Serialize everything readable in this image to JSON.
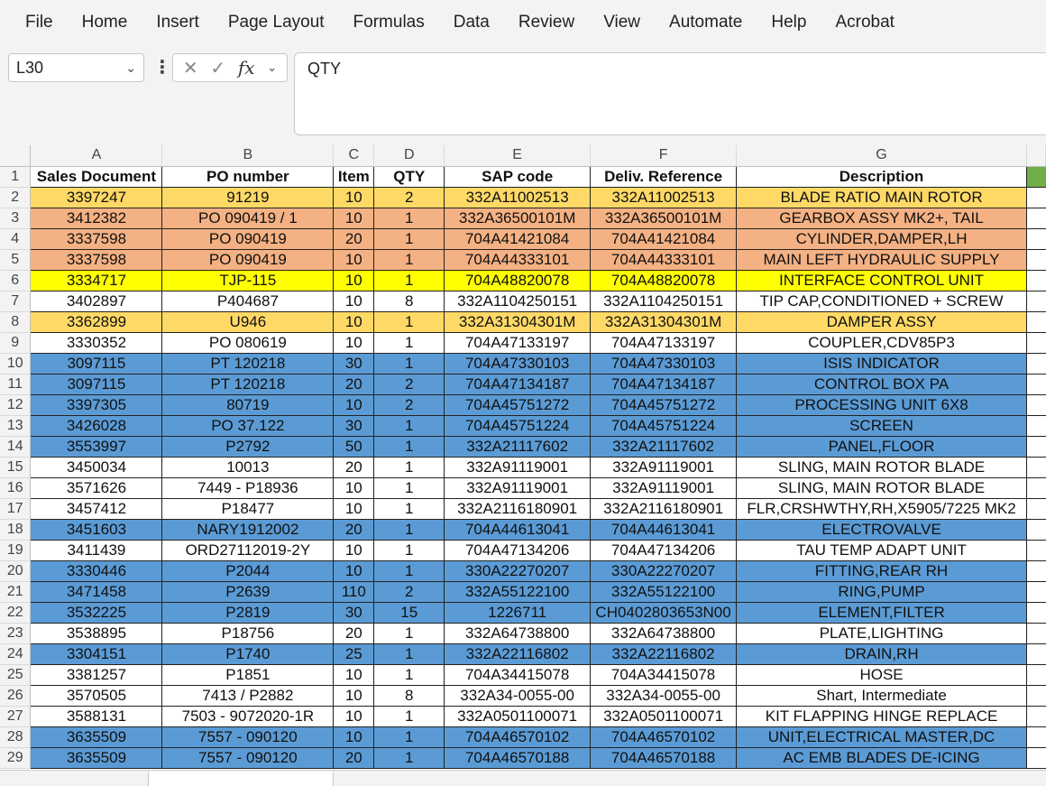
{
  "menu": [
    "File",
    "Home",
    "Insert",
    "Page Layout",
    "Formulas",
    "Data",
    "Review",
    "View",
    "Automate",
    "Help",
    "Acrobat"
  ],
  "name_box": "L30",
  "formula": "QTY",
  "fx_label": "fx",
  "columns": [
    "A",
    "B",
    "C",
    "D",
    "E",
    "F",
    "G"
  ],
  "header": [
    "Sales Document",
    "PO number",
    "Item",
    "QTY",
    "SAP code",
    "Deliv. Reference",
    "Description"
  ],
  "colors": {
    "orange": "#ffd966",
    "salmon": "#f4b183",
    "yellow": "#ffff00",
    "blue": "#5b9bd5",
    "white": "#ffffff",
    "green": "#70ad47"
  },
  "rows": [
    {
      "n": "2",
      "fill": "orange",
      "cells": [
        "3397247",
        "91219",
        "10",
        "2",
        "332A11002513",
        "332A11002513",
        "BLADE RATIO MAIN ROTOR"
      ]
    },
    {
      "n": "3",
      "fill": "salmon",
      "cells": [
        "3412382",
        "PO 090419 / 1",
        "10",
        "1",
        "332A36500101M",
        "332A36500101M",
        "GEARBOX ASSY MK2+, TAIL"
      ]
    },
    {
      "n": "4",
      "fill": "salmon",
      "cells": [
        "3337598",
        "PO 090419",
        "20",
        "1",
        "704A41421084",
        "704A41421084",
        "CYLINDER,DAMPER,LH"
      ]
    },
    {
      "n": "5",
      "fill": "salmon",
      "cells": [
        "3337598",
        "PO 090419",
        "10",
        "1",
        "704A44333101",
        "704A44333101",
        "MAIN LEFT HYDRAULIC SUPPLY"
      ]
    },
    {
      "n": "6",
      "fill": "yellow",
      "cells": [
        "3334717",
        "TJP-115",
        "10",
        "1",
        "704A48820078",
        "704A48820078",
        "INTERFACE CONTROL UNIT"
      ]
    },
    {
      "n": "7",
      "fill": "white",
      "cells": [
        "3402897",
        "P404687",
        "10",
        "8",
        "332A1104250151",
        "332A1104250151",
        "TIP CAP,CONDITIONED + SCREW"
      ]
    },
    {
      "n": "8",
      "fill": "orange",
      "cells": [
        "3362899",
        "U946",
        "10",
        "1",
        "332A31304301M",
        "332A31304301M",
        "DAMPER ASSY"
      ]
    },
    {
      "n": "9",
      "fill": "white",
      "cells": [
        "3330352",
        "PO 080619",
        "10",
        "1",
        "704A47133197",
        "704A47133197",
        "COUPLER,CDV85P3"
      ]
    },
    {
      "n": "10",
      "fill": "blue",
      "cells": [
        "3097115",
        "PT 120218",
        "30",
        "1",
        "704A47330103",
        "704A47330103",
        "ISIS INDICATOR"
      ]
    },
    {
      "n": "11",
      "fill": "blue",
      "cells": [
        "3097115",
        "PT 120218",
        "20",
        "2",
        "704A47134187",
        "704A47134187",
        "CONTROL BOX PA"
      ]
    },
    {
      "n": "12",
      "fill": "blue",
      "cells": [
        "3397305",
        "80719",
        "10",
        "2",
        "704A45751272",
        "704A45751272",
        "PROCESSING UNIT 6X8"
      ]
    },
    {
      "n": "13",
      "fill": "blue",
      "cells": [
        "3426028",
        "PO 37.122",
        "30",
        "1",
        "704A45751224",
        "704A45751224",
        "SCREEN"
      ]
    },
    {
      "n": "14",
      "fill": "blue",
      "cells": [
        "3553997",
        "P2792",
        "50",
        "1",
        "332A21117602",
        "332A21117602",
        "PANEL,FLOOR"
      ]
    },
    {
      "n": "15",
      "fill": "white",
      "cells": [
        "3450034",
        "10013",
        "20",
        "1",
        "332A91119001",
        "332A91119001",
        "SLING, MAIN ROTOR BLADE"
      ]
    },
    {
      "n": "16",
      "fill": "white",
      "cells": [
        "3571626",
        "7449 - P18936",
        "10",
        "1",
        "332A91119001",
        "332A91119001",
        "SLING, MAIN ROTOR BLADE"
      ]
    },
    {
      "n": "17",
      "fill": "white",
      "cells": [
        "3457412",
        "P18477",
        "10",
        "1",
        "332A2116180901",
        "332A2116180901",
        "FLR,CRSHWTHY,RH,X5905/7225 MK2"
      ]
    },
    {
      "n": "18",
      "fill": "blue",
      "cells": [
        "3451603",
        "NARY1912002",
        "20",
        "1",
        "704A44613041",
        "704A44613041",
        "ELECTROVALVE"
      ]
    },
    {
      "n": "19",
      "fill": "white",
      "cells": [
        "3411439",
        "ORD27112019-2Y",
        "10",
        "1",
        "704A47134206",
        "704A47134206",
        "TAU TEMP ADAPT UNIT"
      ]
    },
    {
      "n": "20",
      "fill": "blue",
      "cells": [
        "3330446",
        "P2044",
        "10",
        "1",
        "330A22270207",
        "330A22270207",
        "FITTING,REAR RH"
      ]
    },
    {
      "n": "21",
      "fill": "blue",
      "cells": [
        "3471458",
        "P2639",
        "110",
        "2",
        "332A55122100",
        "332A55122100",
        "RING,PUMP"
      ]
    },
    {
      "n": "22",
      "fill": "blue",
      "cells": [
        "3532225",
        "P2819",
        "30",
        "15",
        "1226711",
        "CH0402803653N00",
        "ELEMENT,FILTER"
      ]
    },
    {
      "n": "23",
      "fill": "white",
      "cells": [
        "3538895",
        "P18756",
        "20",
        "1",
        "332A64738800",
        "332A64738800",
        "PLATE,LIGHTING"
      ]
    },
    {
      "n": "24",
      "fill": "blue",
      "cells": [
        "3304151",
        "P1740",
        "25",
        "1",
        "332A22116802",
        "332A22116802",
        "DRAIN,RH"
      ]
    },
    {
      "n": "25",
      "fill": "white",
      "cells": [
        "3381257",
        "P1851",
        "10",
        "1",
        "704A34415078",
        "704A34415078",
        "HOSE"
      ]
    },
    {
      "n": "26",
      "fill": "white",
      "cells": [
        "3570505",
        "7413 / P2882",
        "10",
        "8",
        "332A34-0055-00",
        "332A34-0055-00",
        "Shart, Intermediate"
      ]
    },
    {
      "n": "27",
      "fill": "white",
      "cells": [
        "3588131",
        "7503 - 9072020-1R",
        "10",
        "1",
        "332A0501100071",
        "332A0501100071",
        "KIT FLAPPING HINGE REPLACE"
      ]
    },
    {
      "n": "28",
      "fill": "blue",
      "cells": [
        "3635509",
        "7557 - 090120",
        "10",
        "1",
        "704A46570102",
        "704A46570102",
        "UNIT,ELECTRICAL MASTER,DC"
      ]
    },
    {
      "n": "29",
      "fill": "blue",
      "cells": [
        "3635509",
        "7557 - 090120",
        "20",
        "1",
        "704A46570188",
        "704A46570188",
        "AC EMB BLADES DE-ICING"
      ]
    }
  ]
}
